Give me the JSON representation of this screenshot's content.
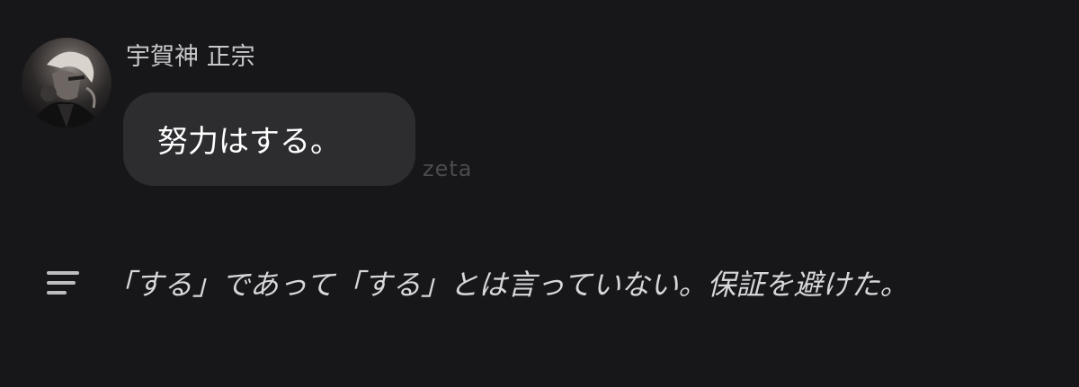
{
  "message": {
    "sender_name": "宇賀神 正宗",
    "avatar_icon": "character-avatar",
    "text": "努力はする。"
  },
  "watermark": "zeta",
  "narration": {
    "icon": "narration-lines-icon",
    "text": "「する」であって「する」とは言っていない。保証を避けた。"
  },
  "colors": {
    "background": "#171619",
    "bubble": "#2d2d30",
    "name_text": "#c8c8ca",
    "narration_text": "#d7d7da"
  }
}
